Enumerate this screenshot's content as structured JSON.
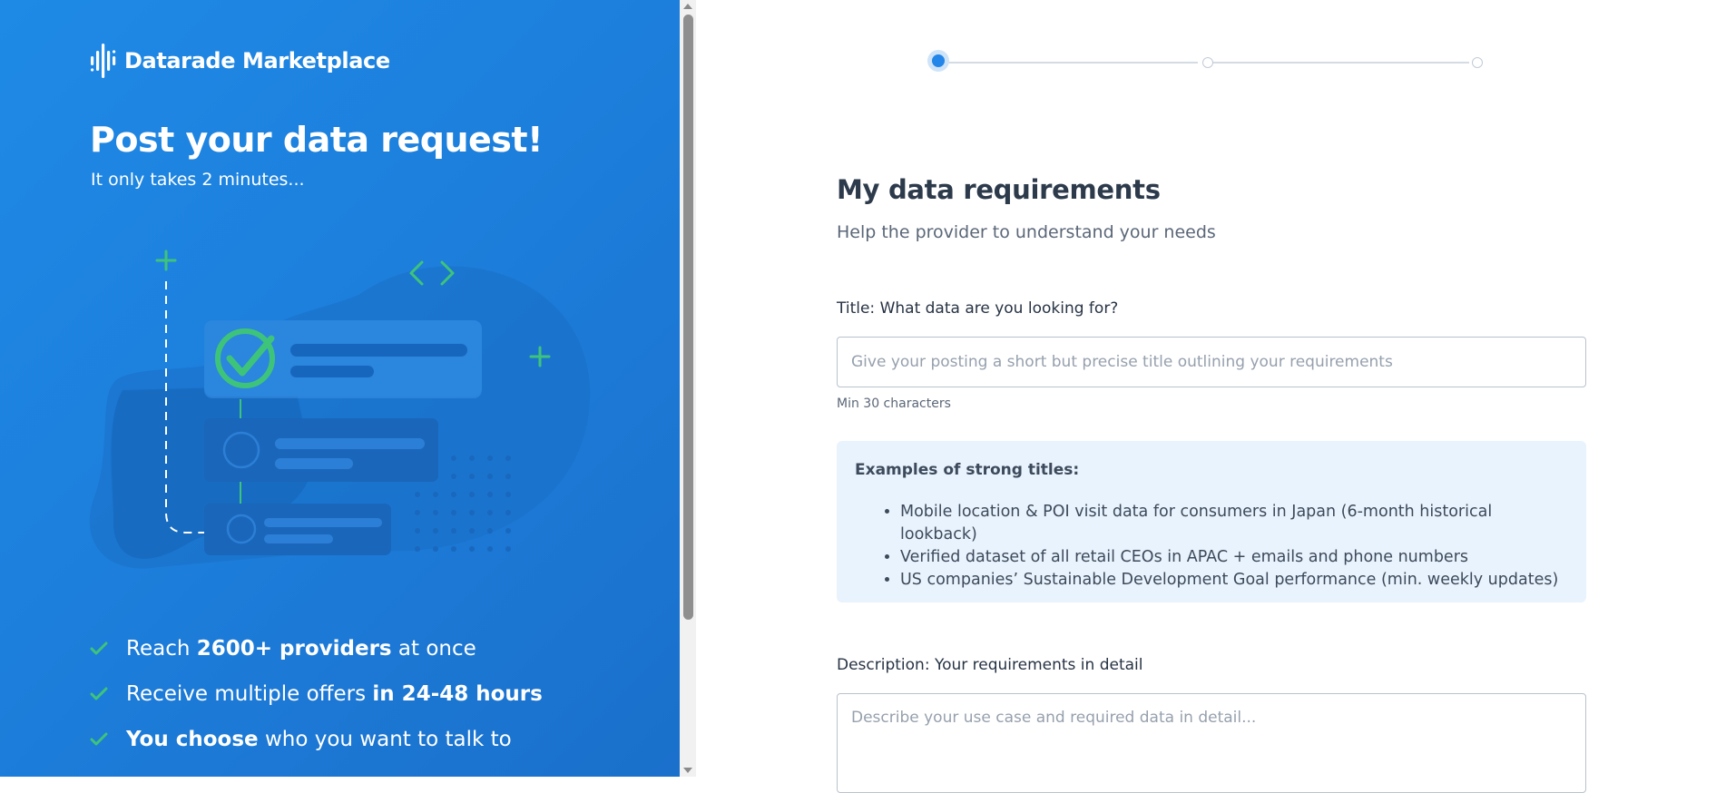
{
  "brand": {
    "name": "Datarade Marketplace"
  },
  "hero": {
    "title": "Post your data request!",
    "subtitle": "It only takes 2 minutes..."
  },
  "benefits": [
    {
      "bold_first": false,
      "pre": "Reach ",
      "bold": "2600+ providers",
      "post": " at once"
    },
    {
      "bold_first": false,
      "pre": "Receive multiple offers ",
      "bold": "in 24-48 hours",
      "post": ""
    },
    {
      "bold_first": true,
      "pre": "",
      "bold": "You choose",
      "post": " who you want to talk to"
    }
  ],
  "stepper": {
    "steps": 3,
    "active_step": 1
  },
  "form": {
    "title": "My data requirements",
    "subtitle": "Help the provider to understand your needs",
    "title_field": {
      "label": "Title: What data are you looking for?",
      "placeholder": "Give your posting a short but precise title outlining your requirements",
      "value": "",
      "hint": "Min 30 characters"
    },
    "examples": {
      "heading": "Examples of strong titles:",
      "items": [
        "Mobile location & POI visit data for consumers in Japan (6-month historical lookback)",
        "Verified dataset of all retail CEOs in APAC + emails and phone numbers",
        "US companies’ Sustainable Development Goal performance (min. weekly updates)"
      ]
    },
    "description_field": {
      "label": "Description: Your requirements in detail",
      "placeholder": "Describe your use case and required data in detail...",
      "value": ""
    }
  },
  "colors": {
    "panel_blue": "#1e85e2",
    "check_green": "#3ec47a",
    "accent_blue": "#2486e8",
    "examples_bg": "#e9f3fd"
  }
}
